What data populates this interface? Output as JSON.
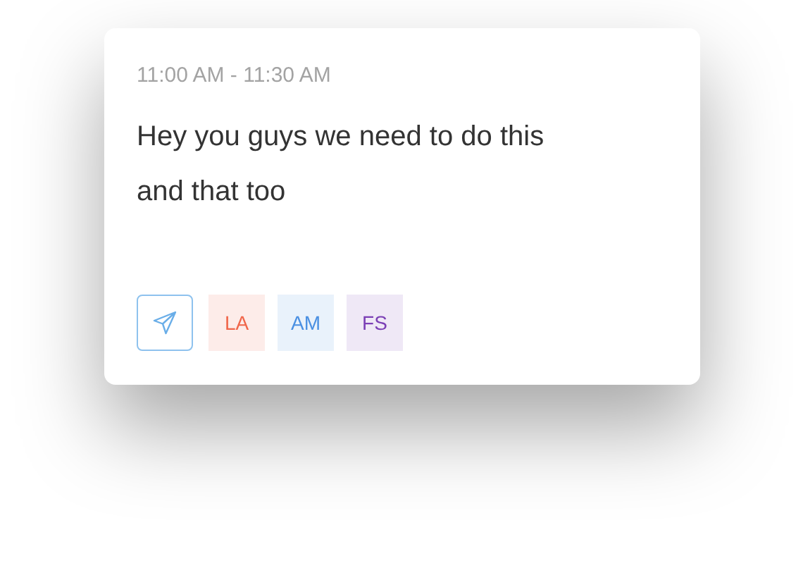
{
  "event": {
    "time": "11:00 AM - 11:30 AM",
    "message": "Hey you guys we need to do this and that too",
    "attendees": [
      {
        "initials": "LA",
        "color": "#f0664a"
      },
      {
        "initials": "AM",
        "color": "#4a90e2"
      },
      {
        "initials": "FS",
        "color": "#7b3fb5"
      }
    ]
  }
}
